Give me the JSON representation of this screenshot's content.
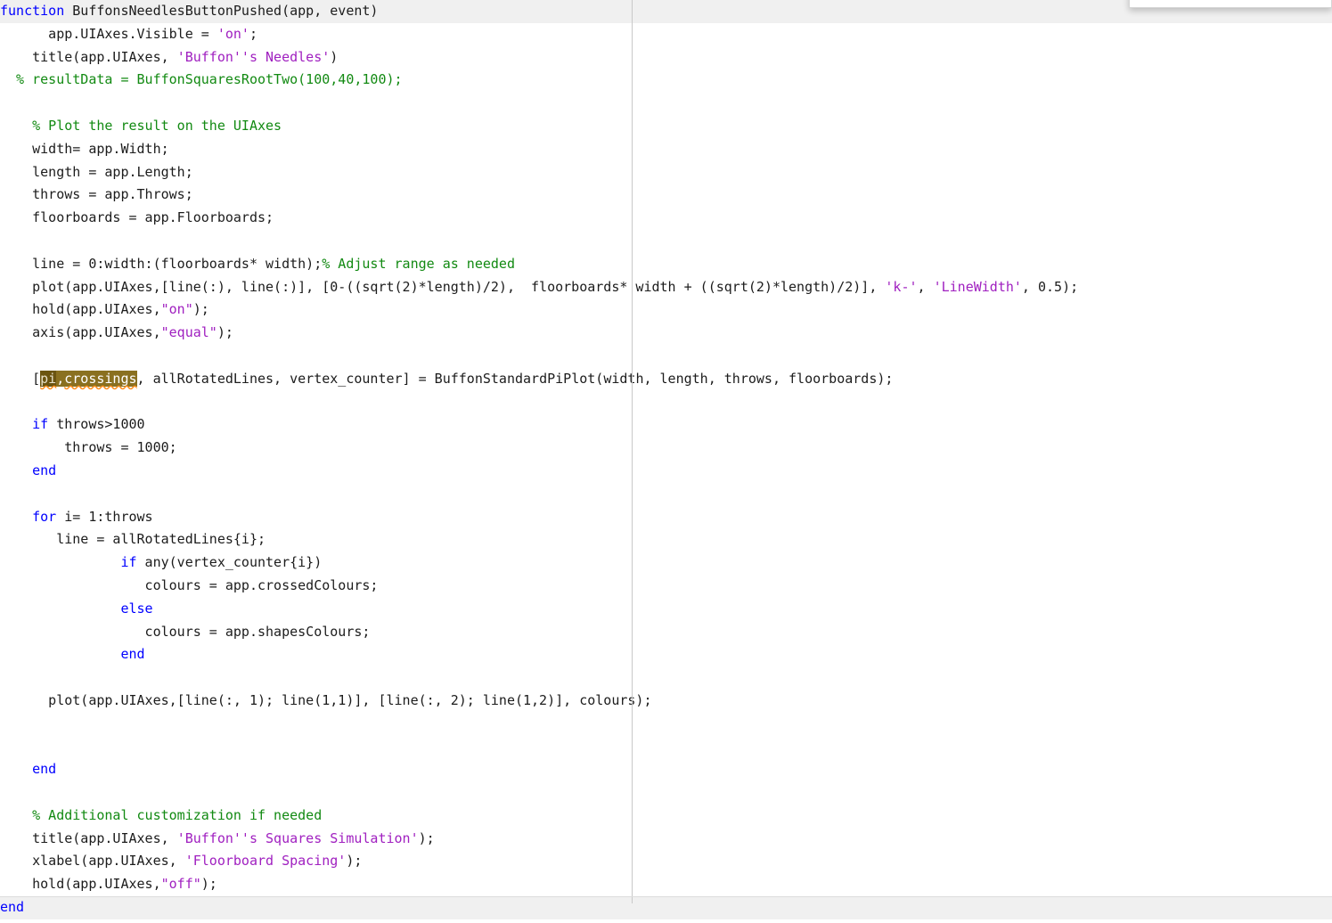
{
  "editor": {
    "language": "MATLAB",
    "colors": {
      "keyword": "#0000ff",
      "comment": "#128a12",
      "string": "#a020c0",
      "plain": "#1c1c1c",
      "function_band": "#f0f0f0",
      "selection": "#6b5410",
      "occurrence_highlight": "#8a7020",
      "wavy_underline": "#ff8c1a",
      "column_guide": "#c9c9c9",
      "background": "#ffffff"
    },
    "selected_token": "pi",
    "highlighted_token": "crossings",
    "column_guide_label": "column-width-guide"
  },
  "lines": [
    {
      "n": 1,
      "band": true,
      "spans": [
        {
          "t": "function ",
          "c": "kw"
        },
        {
          "t": "BuffonsNeedlesButtonPushed(app, event)",
          "c": "pln"
        }
      ]
    },
    {
      "n": 2,
      "band": false,
      "spans": [
        {
          "t": "      app.UIAxes.Visible = ",
          "c": "pln"
        },
        {
          "t": "'on'",
          "c": "str"
        },
        {
          "t": ";",
          "c": "pln"
        }
      ]
    },
    {
      "n": 3,
      "band": false,
      "spans": [
        {
          "t": "    title(app.UIAxes, ",
          "c": "pln"
        },
        {
          "t": "'Buffon''s Needles'",
          "c": "str"
        },
        {
          "t": ")",
          "c": "pln"
        }
      ]
    },
    {
      "n": 4,
      "band": false,
      "spans": [
        {
          "t": "  % resultData = BuffonSquaresRootTwo(100,40,100);",
          "c": "cmt"
        }
      ]
    },
    {
      "n": 5,
      "band": false,
      "spans": [
        {
          "t": "",
          "c": "pln"
        }
      ]
    },
    {
      "n": 6,
      "band": false,
      "spans": [
        {
          "t": "    % Plot the result on the UIAxes",
          "c": "cmt"
        }
      ]
    },
    {
      "n": 7,
      "band": false,
      "spans": [
        {
          "t": "    width= app.Width;",
          "c": "pln"
        }
      ]
    },
    {
      "n": 8,
      "band": false,
      "spans": [
        {
          "t": "    length = app.Length;",
          "c": "pln"
        }
      ]
    },
    {
      "n": 9,
      "band": false,
      "spans": [
        {
          "t": "    throws = app.Throws;",
          "c": "pln"
        }
      ]
    },
    {
      "n": 10,
      "band": false,
      "spans": [
        {
          "t": "    floorboards = app.Floorboards;",
          "c": "pln"
        }
      ]
    },
    {
      "n": 11,
      "band": false,
      "spans": [
        {
          "t": "",
          "c": "pln"
        }
      ]
    },
    {
      "n": 12,
      "band": false,
      "spans": [
        {
          "t": "    line = 0:width:(floorboards* width);",
          "c": "pln"
        },
        {
          "t": "% Adjust range as needed",
          "c": "cmt"
        }
      ]
    },
    {
      "n": 13,
      "band": false,
      "spans": [
        {
          "t": "    plot(app.UIAxes,[line(:), line(:)], [0-((sqrt(2)*length)/2),  floorboards* width + ((sqrt(2)*length)/2)], ",
          "c": "pln"
        },
        {
          "t": "'k-'",
          "c": "str"
        },
        {
          "t": ", ",
          "c": "pln"
        },
        {
          "t": "'LineWidth'",
          "c": "str"
        },
        {
          "t": ", 0.5);",
          "c": "pln"
        }
      ]
    },
    {
      "n": 14,
      "band": false,
      "spans": [
        {
          "t": "    hold(app.UIAxes,",
          "c": "pln"
        },
        {
          "t": "\"on\"",
          "c": "str"
        },
        {
          "t": ");",
          "c": "pln"
        }
      ]
    },
    {
      "n": 15,
      "band": false,
      "spans": [
        {
          "t": "    axis(app.UIAxes,",
          "c": "pln"
        },
        {
          "t": "\"equal\"",
          "c": "str"
        },
        {
          "t": ");",
          "c": "pln"
        }
      ]
    },
    {
      "n": 16,
      "band": false,
      "spans": [
        {
          "t": "",
          "c": "pln"
        }
      ]
    },
    {
      "n": 17,
      "band": false,
      "spans": [
        {
          "t": "    [",
          "c": "pln"
        },
        {
          "t": "pi",
          "c": "sel wav"
        },
        {
          "t": ",",
          "c": "hl"
        },
        {
          "t": "crossings",
          "c": "hl wav"
        },
        {
          "t": ", allRotatedLines, vertex_counter] = BuffonStandardPiPlot(width, length, throws, floorboards);",
          "c": "pln"
        }
      ]
    },
    {
      "n": 18,
      "band": false,
      "spans": [
        {
          "t": "",
          "c": "pln"
        }
      ]
    },
    {
      "n": 19,
      "band": false,
      "spans": [
        {
          "t": "    ",
          "c": "pln"
        },
        {
          "t": "if",
          "c": "kw"
        },
        {
          "t": " throws>1000",
          "c": "pln"
        }
      ]
    },
    {
      "n": 20,
      "band": false,
      "spans": [
        {
          "t": "        throws = 1000;",
          "c": "pln"
        }
      ]
    },
    {
      "n": 21,
      "band": false,
      "spans": [
        {
          "t": "    ",
          "c": "pln"
        },
        {
          "t": "end",
          "c": "kw"
        }
      ]
    },
    {
      "n": 22,
      "band": false,
      "spans": [
        {
          "t": "",
          "c": "pln"
        }
      ]
    },
    {
      "n": 23,
      "band": false,
      "spans": [
        {
          "t": "    ",
          "c": "pln"
        },
        {
          "t": "for",
          "c": "kw"
        },
        {
          "t": " i= 1:throws",
          "c": "pln"
        }
      ]
    },
    {
      "n": 24,
      "band": false,
      "spans": [
        {
          "t": "       line = allRotatedLines{i};",
          "c": "pln"
        }
      ]
    },
    {
      "n": 25,
      "band": false,
      "spans": [
        {
          "t": "               ",
          "c": "pln"
        },
        {
          "t": "if",
          "c": "kw"
        },
        {
          "t": " any(vertex_counter{i})",
          "c": "pln"
        }
      ]
    },
    {
      "n": 26,
      "band": false,
      "spans": [
        {
          "t": "                  colours = app.crossedColours;",
          "c": "pln"
        }
      ]
    },
    {
      "n": 27,
      "band": false,
      "spans": [
        {
          "t": "               ",
          "c": "pln"
        },
        {
          "t": "else",
          "c": "kw"
        }
      ]
    },
    {
      "n": 28,
      "band": false,
      "spans": [
        {
          "t": "                  colours = app.shapesColours;",
          "c": "pln"
        }
      ]
    },
    {
      "n": 29,
      "band": false,
      "spans": [
        {
          "t": "               ",
          "c": "pln"
        },
        {
          "t": "end",
          "c": "kw"
        }
      ]
    },
    {
      "n": 30,
      "band": false,
      "spans": [
        {
          "t": "",
          "c": "pln"
        }
      ]
    },
    {
      "n": 31,
      "band": false,
      "spans": [
        {
          "t": "      plot(app.UIAxes,[line(:, 1); line(1,1)], [line(:, 2); line(1,2)], colours);",
          "c": "pln"
        }
      ]
    },
    {
      "n": 32,
      "band": false,
      "spans": [
        {
          "t": "",
          "c": "pln"
        }
      ]
    },
    {
      "n": 33,
      "band": false,
      "spans": [
        {
          "t": "",
          "c": "pln"
        }
      ]
    },
    {
      "n": 34,
      "band": false,
      "spans": [
        {
          "t": "    ",
          "c": "pln"
        },
        {
          "t": "end",
          "c": "kw"
        }
      ]
    },
    {
      "n": 35,
      "band": false,
      "spans": [
        {
          "t": "",
          "c": "pln"
        }
      ]
    },
    {
      "n": 36,
      "band": false,
      "spans": [
        {
          "t": "    % Additional customization if needed",
          "c": "cmt"
        }
      ]
    },
    {
      "n": 37,
      "band": false,
      "spans": [
        {
          "t": "    title(app.UIAxes, ",
          "c": "pln"
        },
        {
          "t": "'Buffon''s Squares Simulation'",
          "c": "str"
        },
        {
          "t": ");",
          "c": "pln"
        }
      ]
    },
    {
      "n": 38,
      "band": false,
      "spans": [
        {
          "t": "    xlabel(app.UIAxes, ",
          "c": "pln"
        },
        {
          "t": "'Floorboard Spacing'",
          "c": "str"
        },
        {
          "t": ");",
          "c": "pln"
        }
      ]
    },
    {
      "n": 39,
      "band": false,
      "spans": [
        {
          "t": "    hold(app.UIAxes,",
          "c": "pln"
        },
        {
          "t": "\"off\"",
          "c": "str"
        },
        {
          "t": ");",
          "c": "pln"
        }
      ]
    },
    {
      "n": 40,
      "band": true,
      "spans": [
        {
          "t": "end",
          "c": "kw"
        }
      ]
    }
  ]
}
